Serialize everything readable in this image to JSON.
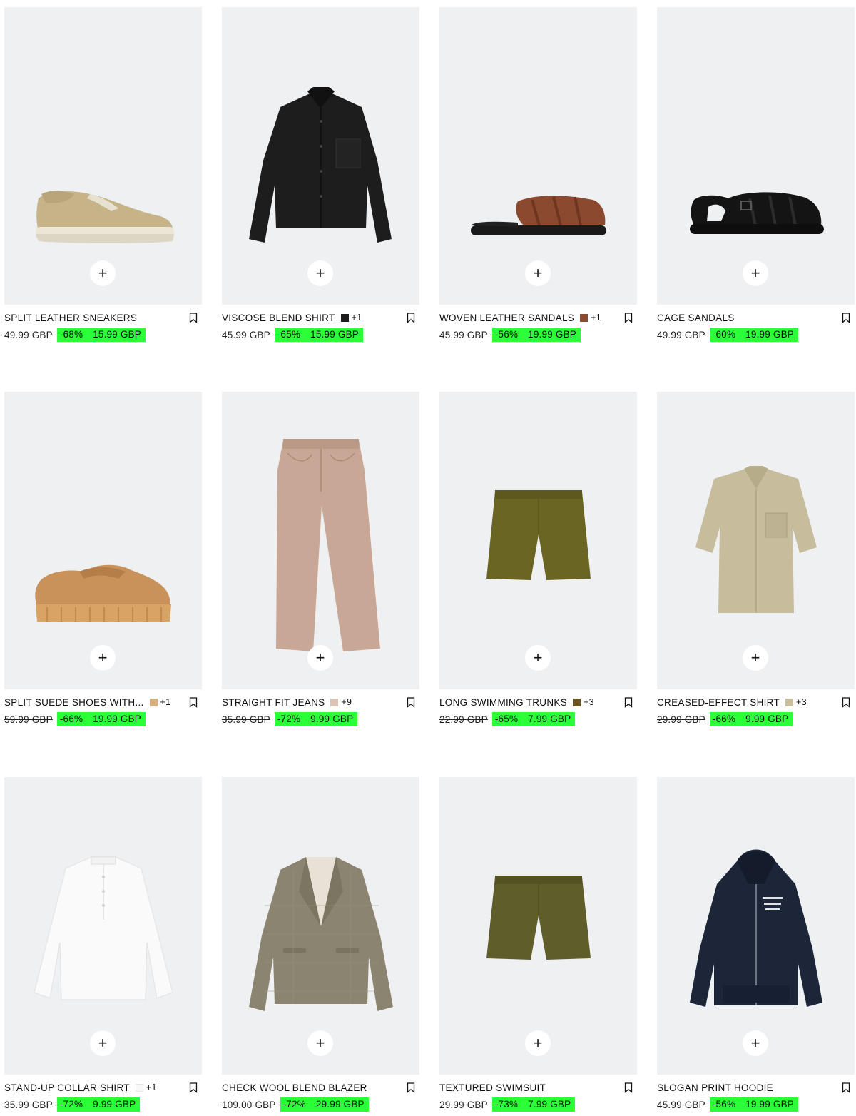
{
  "add_label": "+",
  "products": [
    {
      "name": "SPLIT LEATHER SNEAKERS",
      "swatch": null,
      "more_colors": "",
      "old_price": "49.99 GBP",
      "discount": "-68%",
      "price": "15.99 GBP",
      "icon": "sneaker-icon"
    },
    {
      "name": "VISCOSE BLEND SHIRT",
      "swatch": "#1c1c1c",
      "more_colors": "+1",
      "old_price": "45.99 GBP",
      "discount": "-65%",
      "price": "15.99 GBP",
      "icon": "shirt-icon"
    },
    {
      "name": "WOVEN LEATHER SANDALS",
      "swatch": "#8a4a32",
      "more_colors": "+1",
      "old_price": "45.99 GBP",
      "discount": "-56%",
      "price": "19.99 GBP",
      "icon": "sandal-icon"
    },
    {
      "name": "CAGE SANDALS",
      "swatch": null,
      "more_colors": "",
      "old_price": "49.99 GBP",
      "discount": "-60%",
      "price": "19.99 GBP",
      "icon": "sandal-icon"
    },
    {
      "name": "SPLIT SUEDE SHOES WITH...",
      "swatch": "#d8b07e",
      "more_colors": "+1",
      "old_price": "59.99 GBP",
      "discount": "-66%",
      "price": "19.99 GBP",
      "icon": "shoe-icon"
    },
    {
      "name": "STRAIGHT FIT JEANS",
      "swatch": "#dcc3b5",
      "more_colors": "+9",
      "old_price": "35.99 GBP",
      "discount": "-72%",
      "price": "9.99 GBP",
      "icon": "jeans-icon"
    },
    {
      "name": "LONG SWIMMING TRUNKS",
      "swatch": "#6b5322",
      "more_colors": "+3",
      "old_price": "22.99 GBP",
      "discount": "-65%",
      "price": "7.99 GBP",
      "icon": "shorts-icon"
    },
    {
      "name": "CREASED-EFFECT SHIRT",
      "swatch": "#c9bd9b",
      "more_colors": "+3",
      "old_price": "29.99 GBP",
      "discount": "-66%",
      "price": "9.99 GBP",
      "icon": "shirt-icon"
    },
    {
      "name": "STAND-UP COLLAR SHIRT",
      "swatch": "#f6f8fa",
      "more_colors": "+1",
      "old_price": "35.99 GBP",
      "discount": "-72%",
      "price": "9.99 GBP",
      "icon": "shirt-icon"
    },
    {
      "name": "CHECK WOOL BLEND BLAZER",
      "swatch": null,
      "more_colors": "",
      "old_price": "109.00 GBP",
      "discount": "-72%",
      "price": "29.99 GBP",
      "icon": "blazer-icon"
    },
    {
      "name": "TEXTURED SWIMSUIT",
      "swatch": null,
      "more_colors": "",
      "old_price": "29.99 GBP",
      "discount": "-73%",
      "price": "7.99 GBP",
      "icon": "shorts-icon"
    },
    {
      "name": "SLOGAN PRINT HOODIE",
      "swatch": null,
      "more_colors": "",
      "old_price": "45.99 GBP",
      "discount": "-56%",
      "price": "19.99 GBP",
      "icon": "hoodie-icon"
    }
  ]
}
